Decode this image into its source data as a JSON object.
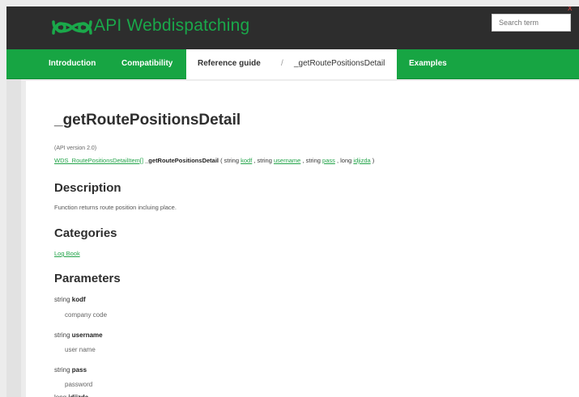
{
  "header": {
    "brand": "API Webdispatching",
    "search_placeholder": "Search term",
    "close_glyph": "x",
    "icons": {
      "logo": "logo-icon",
      "close": "close-icon"
    },
    "colors": {
      "accent": "#17a543",
      "topbar": "#2d2d2d"
    }
  },
  "nav": {
    "introduction": "Introduction",
    "compatibility": "Compatibility",
    "reference": "Reference guide",
    "separator": "/",
    "current": "_getRoutePositionsDetail",
    "examples": "Examples"
  },
  "page": {
    "title": "_getRoutePositionsDetail",
    "api_version": "(API version 2.0)",
    "signature": {
      "return_type": "WDS_RoutePositionsDetailItem[]",
      "func_name": "_getRoutePositionsDetail",
      "open": " ( string ",
      "p1": "kodf",
      "sep1": " , string ",
      "p2": "username",
      "sep2": " , string ",
      "p3": "pass",
      "sep3": " , long ",
      "p4": "idjizda",
      "close": " )"
    },
    "description_heading": "Description",
    "description_text": "Function returns route position incluing place.",
    "categories_heading": "Categories",
    "category_link": "Log Book",
    "parameters_heading": "Parameters",
    "parameters": [
      {
        "type": "string",
        "name": "kodf",
        "desc": "company code"
      },
      {
        "type": "string",
        "name": "username",
        "desc": "user name"
      },
      {
        "type": "string",
        "name": "pass",
        "desc": "password"
      },
      {
        "type": "long",
        "name": "idjizda",
        "desc": ""
      }
    ]
  }
}
